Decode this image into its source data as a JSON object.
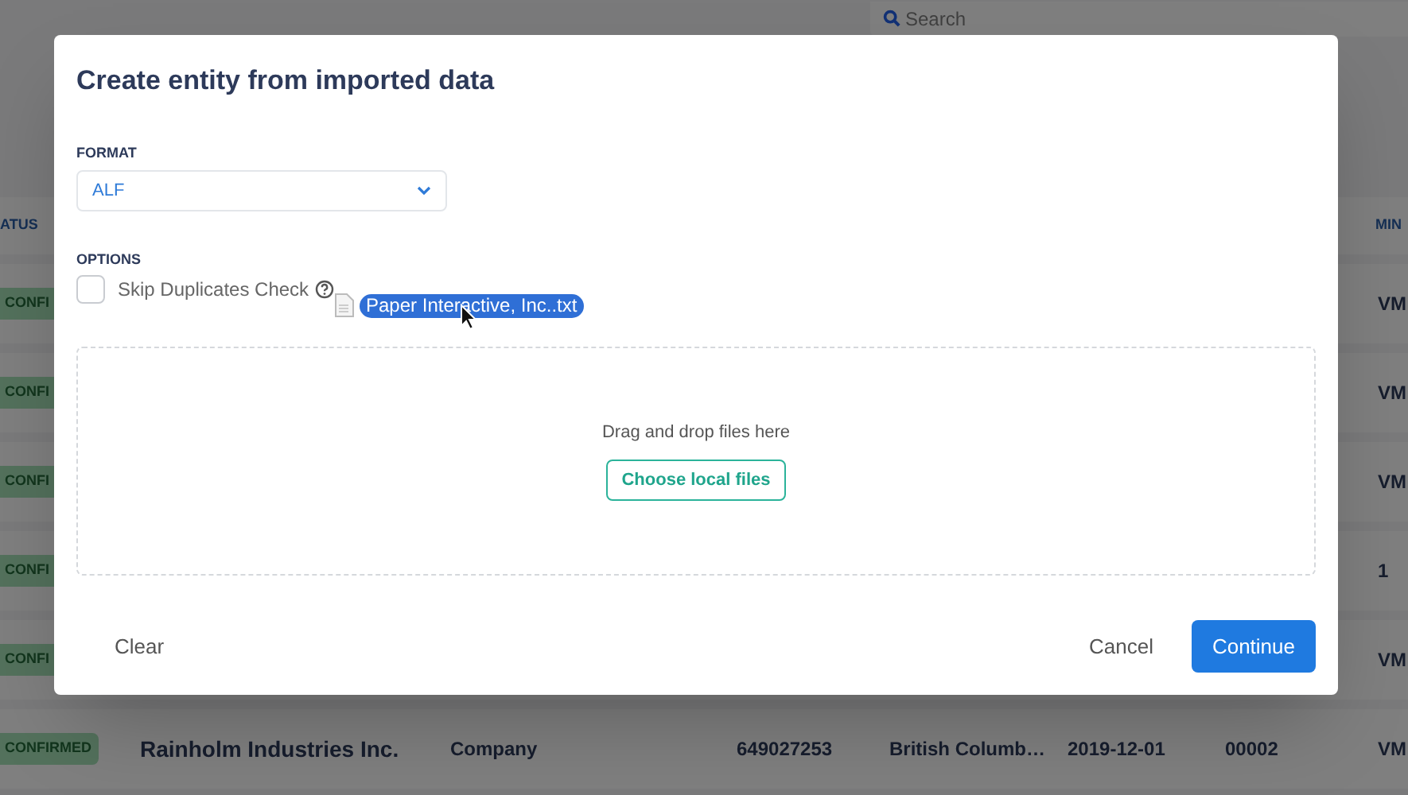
{
  "search": {
    "placeholder": "Search"
  },
  "table": {
    "columns": [
      {
        "label": "ATUS"
      },
      {
        "label": "MIN"
      }
    ],
    "rows": [
      {
        "status": "CONFI",
        "column_8": "VM"
      },
      {
        "status": "CONFI",
        "column_8": "VM"
      },
      {
        "status": "CONFI",
        "column_8": "VM"
      },
      {
        "status": "CONFI",
        "column_8": "1"
      },
      {
        "status": "CONFI",
        "column_8": "VM"
      },
      {
        "status": "CONFIRMED",
        "name": "Rainholm Industries Inc.",
        "type": "Company",
        "number": "649027253",
        "region": "British Columb…",
        "date": "2019-12-01",
        "code": "00002",
        "column_8": "VM"
      }
    ]
  },
  "dialog": {
    "title": "Create entity from imported data",
    "format": {
      "label": "FORMAT",
      "value": "ALF"
    },
    "options": {
      "label": "OPTIONS",
      "checkboxes": [
        {
          "label": "Skip Duplicates Check",
          "checked": false
        }
      ]
    },
    "drag_item": {
      "label": "Paper Interactive, Inc..txt"
    },
    "dropzone": {
      "text": "Drag and drop files here",
      "button": "Choose local files"
    },
    "buttons": [
      {
        "label": "Clear",
        "kind": "text"
      },
      {
        "label": "Cancel",
        "kind": "text"
      },
      {
        "label": "Continue",
        "kind": "primary"
      }
    ]
  }
}
